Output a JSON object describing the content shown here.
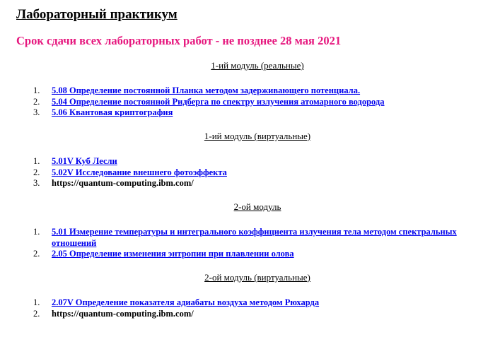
{
  "page": {
    "title": "Лабораторный практикум",
    "deadline": "Срок сдачи всех лабораторных работ - не позднее 28 мая 2021"
  },
  "colors": {
    "deadline": "#e6177e",
    "link": "#0000ee",
    "text": "#000000"
  },
  "sections": [
    {
      "heading": "1-ий модуль (реальные)",
      "items": [
        {
          "num": "1.",
          "text": "5.08 Определение постоянной Планка методом задерживающего потенциала.",
          "link": true
        },
        {
          "num": "2.",
          "text": "5.04 Определение постоянной Ридберга по спектру излучения атомарного водорода",
          "link": true
        },
        {
          "num": "3.",
          "text": "5.06 Квантовая криптография",
          "link": true
        }
      ]
    },
    {
      "heading": "1-ий модуль (виртуальные)",
      "items": [
        {
          "num": "1.",
          "text": "5.01V Куб Лесли",
          "link": true
        },
        {
          "num": "2.",
          "text": "5.02V Исследование внешнего фотоэффекта",
          "link": true
        },
        {
          "num": "3.",
          "text": "https://quantum-computing.ibm.com/",
          "link": false
        }
      ]
    },
    {
      "heading": "2-ой модуль",
      "items": [
        {
          "num": "1.",
          "text": "5.01 Измерение температуры и интегрального коэффициента излучения тела методом спектральных отношений",
          "link": true
        },
        {
          "num": "2.",
          "text": "2.05 Определение изменения энтропии при плавлении олова",
          "link": true
        }
      ]
    },
    {
      "heading": "2-ой модуль (виртуальные)",
      "items": [
        {
          "num": "1.",
          "text": "2.07V Определение показателя адиабаты воздуха методом Рюхарда",
          "link": true
        },
        {
          "num": "2.",
          "text": "https://quantum-computing.ibm.com/",
          "link": false
        }
      ]
    }
  ]
}
